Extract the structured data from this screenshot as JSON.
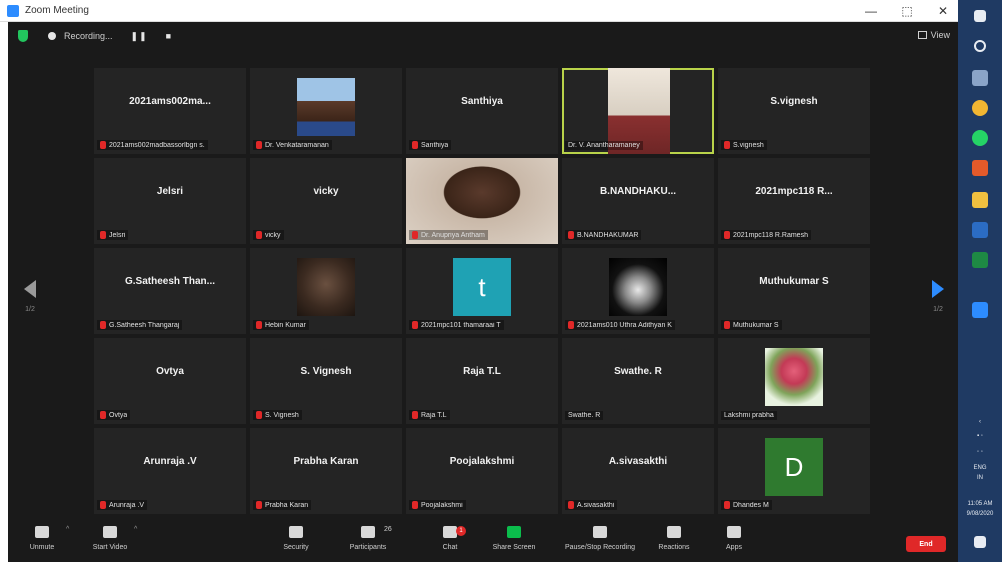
{
  "window": {
    "title": "Zoom Meeting",
    "controls": [
      "—",
      "⬚",
      "✕"
    ]
  },
  "topbar": {
    "recording_label": "Recording...",
    "pause_icon": "pause-icon",
    "stop_icon": "stop-icon",
    "view_label": "View"
  },
  "navigation": {
    "page_left": "1/2",
    "page_right": "1/2"
  },
  "tiles": [
    {
      "display": "2021ams002ma...",
      "name": "2021ams002madbassorlbgn s.",
      "muted": true,
      "avatar": "none"
    },
    {
      "display": "",
      "name": "Dr. Venkataramanan",
      "muted": true,
      "avatar": "photo-man"
    },
    {
      "display": "Santhiya",
      "name": "Santhiya",
      "muted": true,
      "avatar": "none"
    },
    {
      "display": "",
      "name": "Dr. V. Anantharamaney",
      "muted": false,
      "avatar": "video-room",
      "active": true
    },
    {
      "display": "S.vignesh",
      "name": "S.vignesh",
      "muted": true,
      "avatar": "none"
    },
    {
      "display": "Jelsri",
      "name": "Jelsri",
      "muted": true,
      "avatar": "none"
    },
    {
      "display": "vicky",
      "name": "vicky",
      "muted": true,
      "avatar": "none"
    },
    {
      "display": "",
      "name": "Dr. Anupriya Antham",
      "muted": true,
      "avatar": "video-person"
    },
    {
      "display": "B.NANDHAKU...",
      "name": "B.NANDHAKUMAR",
      "muted": true,
      "avatar": "none"
    },
    {
      "display": "2021mpc118 R...",
      "name": "2021mpc118 R.Ramesh",
      "muted": true,
      "avatar": "none"
    },
    {
      "display": "G.Satheesh Than...",
      "name": "G.Satheesh Thangaraj",
      "muted": true,
      "avatar": "none"
    },
    {
      "display": "",
      "name": "Hebin Kumar",
      "muted": true,
      "avatar": "photo-beard"
    },
    {
      "display": "",
      "name": "2021mpc101 thamaraai T",
      "muted": true,
      "avatar": "letter-t"
    },
    {
      "display": "",
      "name": "2021ams010 Uthra Adithyan K",
      "muted": true,
      "avatar": "buddha"
    },
    {
      "display": "Muthukumar S",
      "name": "Muthukumar S",
      "muted": true,
      "avatar": "none"
    },
    {
      "display": "Ovtya",
      "name": "Ovtya",
      "muted": true,
      "avatar": "none"
    },
    {
      "display": "S. Vignesh",
      "name": "S. Vignesh",
      "muted": true,
      "avatar": "none"
    },
    {
      "display": "Raja T.L",
      "name": "Raja T.L",
      "muted": true,
      "avatar": "none"
    },
    {
      "display": "Swathe. R",
      "name": "Swathe. R",
      "muted": false,
      "avatar": "none"
    },
    {
      "display": "",
      "name": "Lakshmi prabha",
      "muted": false,
      "avatar": "rose"
    },
    {
      "display": "Arunraja .V",
      "name": "Arunraja .V",
      "muted": true,
      "avatar": "none"
    },
    {
      "display": "Prabha Karan",
      "name": "Prabha Karan",
      "muted": true,
      "avatar": "none"
    },
    {
      "display": "Poojalakshmi",
      "name": "Poojalakshmi",
      "muted": true,
      "avatar": "none"
    },
    {
      "display": "A.sivasakthi",
      "name": "A.sivasakthi",
      "muted": true,
      "avatar": "none"
    },
    {
      "display": "",
      "name": "Dhandes M",
      "muted": true,
      "avatar": "letter-d"
    }
  ],
  "avatar_letters": {
    "t": "t",
    "d": "D"
  },
  "toolbar": {
    "unmute": "Unmute",
    "start_video": "Start Video",
    "security": "Security",
    "participants": "Participants",
    "participants_count": "26",
    "chat": "Chat",
    "chat_badge": "1",
    "share_screen": "Share Screen",
    "pause_recording": "Pause/Stop Recording",
    "reactions": "Reactions",
    "apps": "Apps",
    "end": "End"
  },
  "taskbar": {
    "lang": "ENG",
    "region": "IN",
    "time": "11:05 AM",
    "date": "9/08/2020"
  },
  "colors": {
    "accent": "#2d8cff",
    "end": "#e02828",
    "share": "#0bbd4c",
    "active_border": "#b9d34a"
  }
}
